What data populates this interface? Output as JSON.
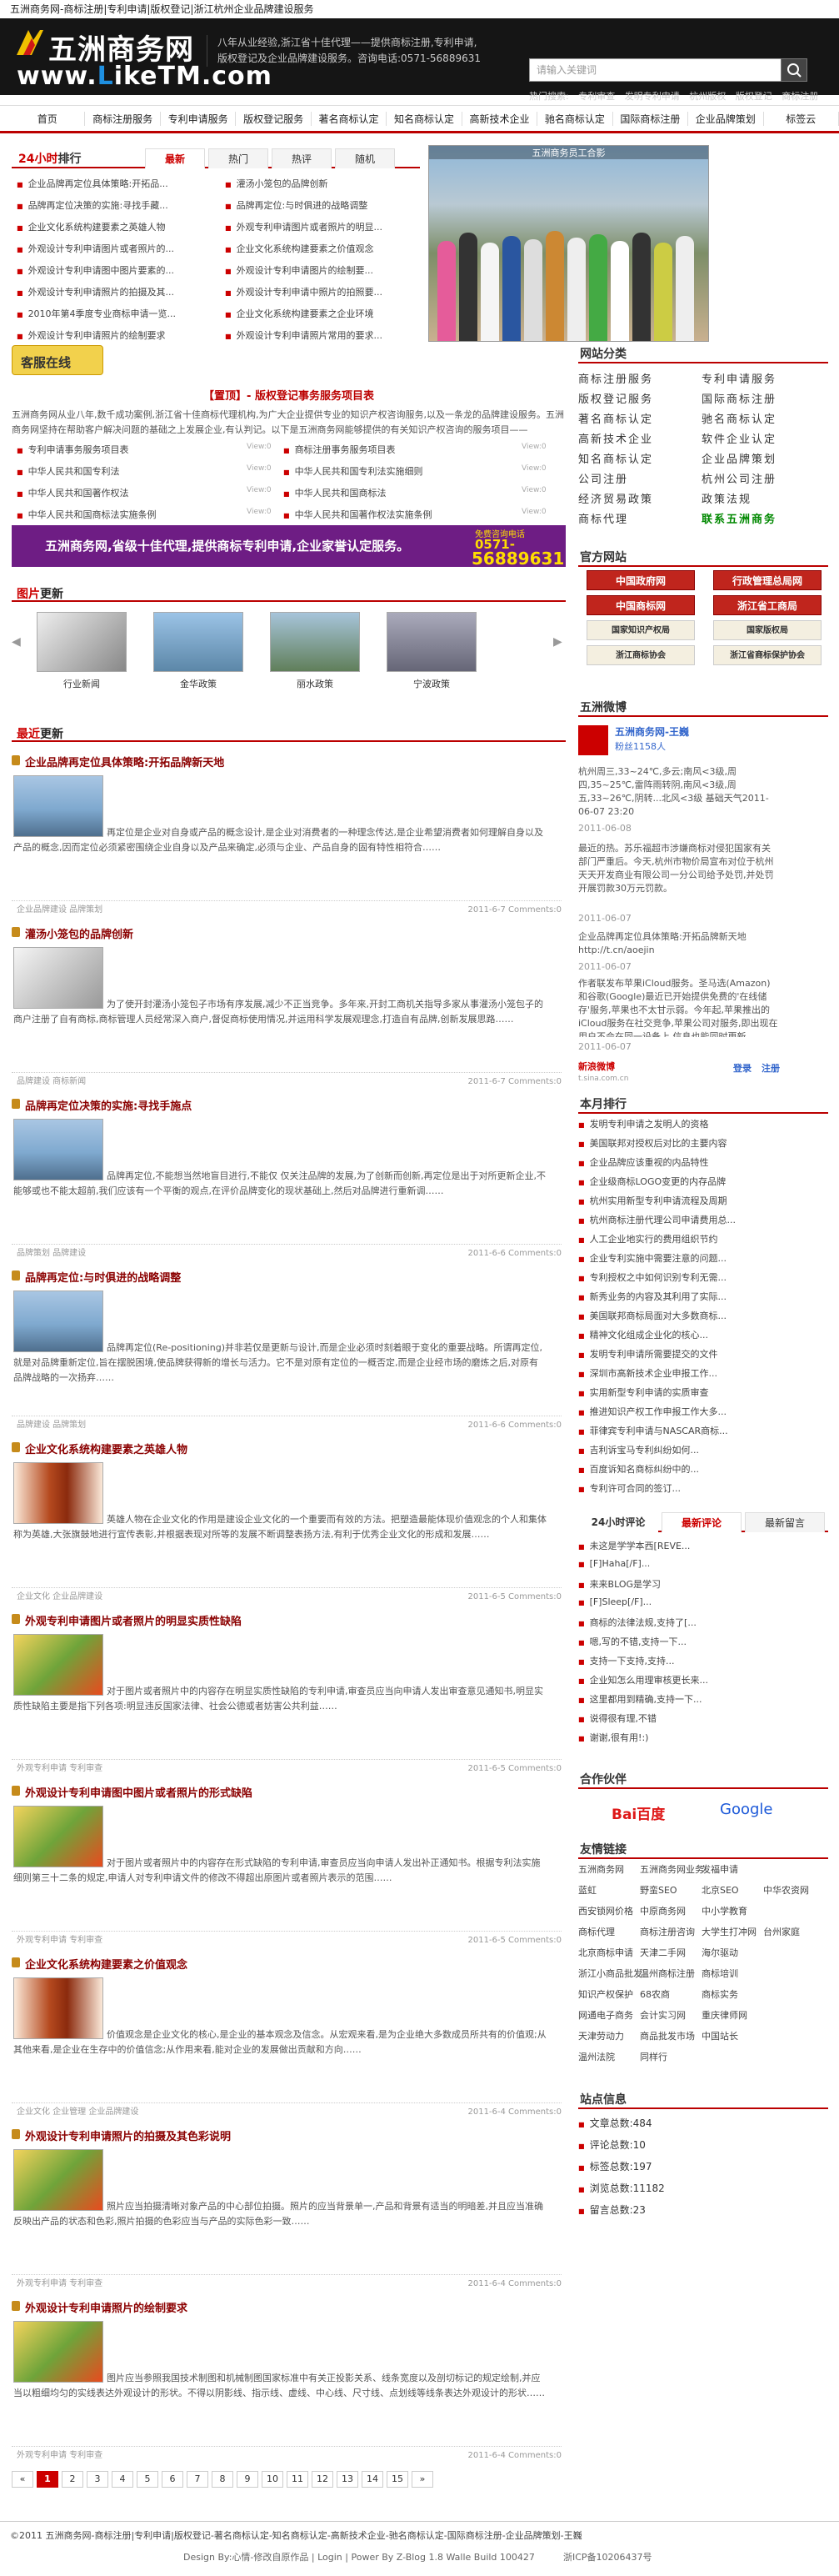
{
  "top_title": "五洲商务网-商标注册|专利申请|版权登记|浙江杭州企业品牌建设服务",
  "logo": {
    "cn": "五洲商务网",
    "en_a": "www.",
    "en_b": "L",
    "en_c": "ikeTM.com"
  },
  "slogan": "八年从业经验,浙江省十佳代理——提供商标注册,专利申请,版权登记及企业品牌建设服务。咨询电话:0571-56889631",
  "search": {
    "placeholder": "请输入关键词"
  },
  "hot": {
    "label": "热门搜索:",
    "items": [
      "专利审查",
      "发明专利申请",
      "杭州版权",
      "版权登记",
      "商标注册"
    ]
  },
  "nav": [
    "首页",
    "商标注册服务",
    "专利申请服务",
    "版权登记服务",
    "著名商标认定",
    "知名商标认定",
    "高新技术企业",
    "驰名商标认定",
    "国际商标注册",
    "企业品牌策划",
    "标签云"
  ],
  "rank": {
    "title_a": "24小时",
    "title_b": "排行",
    "tabs": [
      "最新",
      "热门",
      "热评",
      "随机"
    ],
    "left": [
      "企业品牌再定位具体策略:开拓品...",
      "品牌再定位决策的实施:寻找手藏...",
      "企业文化系统构建要素之英雄人物",
      "外观设计专利申请图片或者照片的...",
      "外观设计专利申请图中图片要素的...",
      "外观设计专利申请照片的拍摄及其...",
      "2010年第4季度专业商标申请一览...",
      "外观设计专利申请照片的绘制要求"
    ],
    "right": [
      "灌汤小笼包的品牌创新",
      "品牌再定位:与时俱进的战略调整",
      "外观专利申请图片或者照片的明显...",
      "企业文化系统构建要素之价值观念",
      "外观设计专利申请图片的绘制要...",
      "外观设计专利申请中照片的拍照要...",
      "企业文化系统构建要素之企业环境",
      "外观设计专利申请照片常用的要求..."
    ]
  },
  "photo_caption": "五洲商务员工合影",
  "online": "客服在线",
  "intro": {
    "head": "【置顶】- 版权登记事务服务项目表",
    "body": "五洲商务网从业八年,数千成功案例,浙江省十佳商标代理机构,为广大企业提供专业的知识产权咨询服务,以及一条龙的品牌建设服务。五洲商务网坚持在帮助客户解决问题的基础之上发展企业,有认判记。以下是五洲商务网能够提供的有关知识产权咨询的服务项目——",
    "items_left": [
      "专利申请事务服务项目表",
      "中华人民共和国专利法",
      "中华人民共和国著作权法",
      "中华人民共和国商标法实施条例"
    ],
    "items_right": [
      "商标注册事务服务项目表",
      "中华人民共和国专利法实施细则",
      "中华人民共和国商标法",
      "中华人民共和国著作权法实施条例"
    ],
    "views": "View:0"
  },
  "ad": {
    "text": "五洲商务网,省级十佳代理,提供商标专利申请,企业家誉认定服务。",
    "phone_label": "免费咨询电话",
    "phone_a": "0571-",
    "phone_b": "56889631"
  },
  "images_section": {
    "title_a": "图片",
    "title_b": "更新",
    "items": [
      "行业新闻",
      "金华政策",
      "丽水政策",
      "宁波政策"
    ]
  },
  "latest_section": {
    "title_a": "最近",
    "title_b": "更新"
  },
  "articles": [
    {
      "title": "企业品牌再定位具体策略:开拓品牌新天地",
      "summary": "再定位是企业对自身或产品的概念设计,是企业对消费者的一种理念传达,是企业希望消费者如何理解自身以及产品的概念,因而定位必须紧密围绕企业自身以及产品来确定,必须与企业、产品自身的固有特性相符合……",
      "tags": "企业品牌建设  品牌策划",
      "date": "2011-6-7 Comments:0",
      "thumb": "city"
    },
    {
      "title": "灌汤小笼包的品牌创新",
      "summary": "为了使开封灌汤小笼包子市场有序发展,减少不正当竞争。多年来,开封工商机关指导多家从事灌汤小笼包子的商户注册了自有商标,商标管理人员经常深入商户,督促商标使用情况,并运用科学发展观理念,打造自有品牌,创新发展思路……",
      "tags": "品牌建设  商标新闻",
      "date": "2011-6-7 Comments:0",
      "thumb": "news"
    },
    {
      "title": "品牌再定位决策的实施:寻找手施点",
      "summary": "品牌再定位,不能想当然地盲目进行,不能仅 仅关注品牌的发展,为了创新而创新,再定位是出于对所更新企业,不能够或也不能太超前,我们应该有一个平衡的观点,在评价品牌变化的现状基础上,然后对品牌进行重新调……",
      "tags": "品牌策划  品牌建设",
      "date": "2011-6-6 Comments:0",
      "thumb": "city"
    },
    {
      "title": "品牌再定位:与时俱进的战略调整",
      "summary": "品牌再定位(Re-positioning)并非若仅是更新与设计,而是企业必须时刻着眼于变化的重要战略。所谓再定位,就是对品牌重新定位,旨在摆脱困境,使品牌获得新的增长与活力。它不是对原有定位的一概否定,而是企业经市场的磨炼之后,对原有品牌战略的一次扬弃……",
      "tags": "品牌建设  品牌策划",
      "date": "2011-6-6 Comments:0",
      "thumb": "city"
    },
    {
      "title": "企业文化系统构建要素之英雄人物",
      "summary": "英雄人物在企业文化的作用是建设企业文化的一个重要而有效的方法。把塑造最能体现价值观念的个人和集体称为英雄,大张旗鼓地进行宣传表彰,并根据表现对所等的发展不断调整表扬方法,有利于优秀企业文化的形成和发展……",
      "tags": "企业文化  企业品牌建设",
      "date": "2011-6-5 Comments:0",
      "thumb": "book"
    },
    {
      "title": "外观专利申请图片或者照片的明显实质性缺陷",
      "summary": "对于图片或者照片中的内容存在明显实质性缺陷的专利申请,审查员应当向申请人发出审查意见通知书,明显实质性缺陷主要是指下列各项:明显违反国家法律、社会公德或者妨害公共利益……",
      "tags": "外观专利申请  专利审查",
      "date": "2011-6-5 Comments:0",
      "thumb": "patent"
    },
    {
      "title": "外观设计专利申请图中图片或者照片的形式缺陷",
      "summary": "对于图片或者照片中的内容存在形式缺陷的专利申请,审查员应当向申请人发出补正通知书。根据专利法实施细则第三十二条的规定,申请人对专利申请文件的修改不得超出原图片或者照片表示的范围……",
      "tags": "外观专利申请  专利审查",
      "date": "2011-6-5 Comments:0",
      "thumb": "patent"
    },
    {
      "title": "企业文化系统构建要素之价值观念",
      "summary": "价值观念是企业文化的核心,是企业的基本观念及信念。从宏观来看,是为企业绝大多数成员所共有的价值观;从其他来看,是企业在生存中的价值信念;从作用来看,能对企业的发展做出贡献和方向……",
      "tags": "企业文化  企业管理  企业品牌建设",
      "date": "2011-6-4 Comments:0",
      "thumb": "book"
    },
    {
      "title": "外观设计专利申请照片的拍摄及其色彩说明",
      "summary": "照片应当拍摄清晰对象产品的中心部位拍摄。照片的应当背景单一,产品和背景有适当的明暗差,并且应当准确反映出产品的状态和色彩,照片拍摄的色彩应当与产品的实际色彩一致……",
      "tags": "外观专利申请  专利审查",
      "date": "2011-6-4 Comments:0",
      "thumb": "patent"
    },
    {
      "title": "外观设计专利申请照片的绘制要求",
      "summary": "图片应当参照我国技术制图和机械制图国家标准中有关正投影关系、线条宽度以及剖切标记的规定绘制,并应当以粗细均匀的实线表达外观设计的形状。不得以阴影线、指示线、虚线、中心线、尺寸线、点划线等线条表达外观设计的形状……",
      "tags": "外观专利申请  专利审查",
      "date": "2011-6-4 Comments:0",
      "thumb": "patent"
    }
  ],
  "pager": [
    "«",
    "1",
    "2",
    "3",
    "4",
    "5",
    "6",
    "7",
    "8",
    "9",
    "10",
    "11",
    "12",
    "13",
    "14",
    "15",
    "»"
  ],
  "right": {
    "cat_title": "网站分类",
    "cats": [
      [
        "商标注册服务",
        "专利申请服务"
      ],
      [
        "版权登记服务",
        "国际商标注册"
      ],
      [
        "著名商标认定",
        "驰名商标认定"
      ],
      [
        "高新技术企业",
        "软件企业认定"
      ],
      [
        "知名商标认定",
        "企业品牌策划"
      ],
      [
        "公司注册",
        "杭州公司注册"
      ],
      [
        "经济贸易政策",
        "政策法规"
      ],
      [
        "商标代理",
        "联系五洲商务"
      ]
    ],
    "gov_title": "官方网站",
    "gov": [
      "中国政府网",
      "行政管理总局网",
      "中国商标网",
      "浙江省工商局",
      "国家知识产权局",
      "国家版权局",
      "浙江商标协会",
      "浙江省商标保护协会"
    ],
    "weibo_title": "五洲微博",
    "weibo_name": "五洲商务网-王巍",
    "weibo_fans": "粉丝1158人",
    "weibo_posts": [
      "杭州周三,33~24℃,多云;南风<3级,周四,35~25℃,雷阵雨转阴,南风<3级,周五,33~26℃,阴转...北风<3级 基础天气2011-06-07 23:20",
      "2011-06-08",
      "最近的热。苏乐福超市涉嫌商标对侵犯国家有关部门严重后。今天,杭州市物价局宣布对位于杭州天天开发商业有限公司一分公司给予处罚,并处罚开展罚款30万元罚款。",
      "2011-06-07",
      "企业品牌再定位具体策略:开拓品牌新天地 http://t.cn/aoejin",
      "2011-06-07",
      "作者联发布苹果iCloud服务。圣马选(Amazon)和谷歌(Google)最近已开始提供免费的'在线储存'服务,苹果也不太甘示弱。今年起,苹果推出的iCloud服务在社交竞争,苹果公司对服务,即出现在用户不会在同一设备上,信息也能同时更新……",
      "2011-06-07"
    ],
    "weibo_logo": "新浪微博",
    "weibo_domain": "t.sina.com.cn",
    "weibo_login": "登录",
    "weibo_reg": "注册",
    "hot_title": "本月排行",
    "hot": [
      "发明专利申请之发明人的资格",
      "美国联邦对授权后对比的主要内容",
      "企业品牌应该重视的内品特性",
      "企业级商标LOGO变更的内存品牌",
      "杭州实用新型专利申请流程及周期",
      "杭州商标注册代理公司申请费用总...",
      "人工企业地实行的费用组织节约",
      "企业专利实施中需要注意的问题...",
      "专利授权之中如何识别专利无需...",
      "新秀业务的内容及其利用了实际...",
      "美国联邦商标局面对大多数商标...",
      "精神文化组成企业化的核心...",
      "发明专利申请所需要提交的文件",
      "深圳市高新技术企业申报工作...",
      "实用新型专利申请的实质审查",
      "推进知识产权工作申报工作大多...",
      "菲律宾专利申请与NASCAR商标...",
      "吉利诉宝马专利纠纷如何...",
      "百度诉知名商标纠纷中的...",
      "专利许可合同的签订..."
    ],
    "tabs2": [
      "24小时评论",
      "最新评论",
      "最新留言"
    ],
    "comments": [
      "未这是学学本西[REVE...",
      "[F]Haha[/F]...",
      "来来BLOG是学习",
      "[F]Sleep[/F]...",
      "商标的法律法规,支持了[...",
      "嗯,写的不错,支持一下...",
      "支持一下支持,支持...",
      "企业知怎么用理审核更长来...",
      "这里都用到精确,支持一下...",
      "说得很有理,不错",
      "谢谢,很有用!:)"
    ],
    "partner_title": "合作伙伴",
    "partners": [
      "Bai百度",
      "Google"
    ],
    "links_title": "友情链接",
    "links": [
      [
        "五洲商务网",
        "五洲商务网业务",
        "发福申请"
      ],
      [
        "蓝虹",
        "野蛮SEO",
        "北京SEO",
        "中华农资网"
      ],
      [
        "西安锁网价格",
        "中原商务网",
        "中小学教育"
      ],
      [
        "商标代理",
        "商标注册咨询",
        "大学生打冲网",
        "台州家庭"
      ],
      [
        "北京商标申请",
        "天津二手网",
        "海尔驱动"
      ],
      [
        "浙江小商品批发",
        "温州商标注册",
        "商标培训"
      ],
      [
        "知识产权保护",
        "68农商",
        "商标实务"
      ],
      [
        "网通电子商务",
        "会计实习网",
        "重庆律师网"
      ],
      [
        "天津劳动力",
        "商品批发市场",
        "中国站长"
      ],
      [
        "温州法院",
        "同样行"
      ]
    ],
    "stat_title": "站点信息",
    "stats": [
      "文章总数:484",
      "评论总数:10",
      "标签总数:197",
      "浏览总数:11182",
      "留言总数:23"
    ]
  },
  "footer": {
    "line1": "©2011 五洲商务网-商标注册|专利申请|版权登记-著名商标认定-知名商标认定-高新技术企业-驰名商标认定-国际商标注册-企业品牌策划-王巍",
    "line2": "Design By:心情-修改自原作品 | Login | Power By Z-Blog 1.8 Walle Build 100427",
    "icp": "浙ICP备10206437号"
  }
}
